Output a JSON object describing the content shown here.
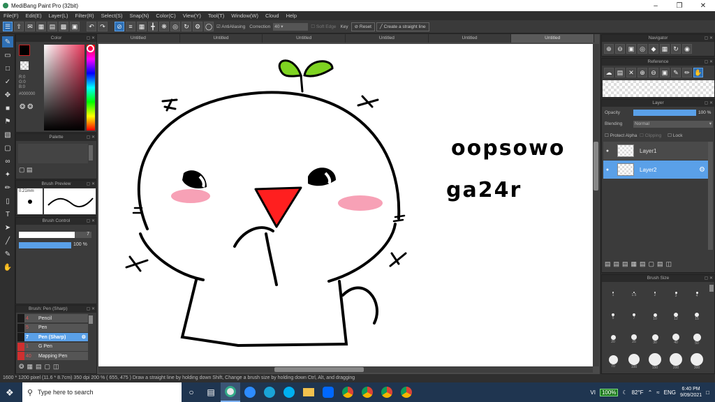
{
  "window": {
    "title": "MediBang Paint Pro (32bit)"
  },
  "menu": [
    "File(F)",
    "Edit(E)",
    "Layer(L)",
    "Filter(R)",
    "Select(S)",
    "Snap(N)",
    "Color(C)",
    "View(Y)",
    "Tool(T)",
    "Window(W)",
    "Cloud",
    "Help"
  ],
  "toolbar": {
    "antialias": "AntiAliasing",
    "correction_label": "Correction",
    "correction_value": "40",
    "soft_edge": "Soft Edge",
    "key": "Key",
    "reset": "Reset",
    "straight_line": "Create a straight line"
  },
  "color_panel": {
    "title": "Color",
    "r": "R:0",
    "g": "G:0",
    "b": "B:0",
    "hex": "#000000"
  },
  "palette": {
    "title": "Palette"
  },
  "brush_preview": {
    "title": "Brush Preview",
    "size": "0.21mm"
  },
  "brush_control": {
    "title": "Brush Control",
    "size_value": "7",
    "opacity_value": "100 %"
  },
  "brush_list": {
    "title": "Brush: Pen (Sharp)",
    "items": [
      {
        "num": "4",
        "name": "Pencil",
        "color": "#1a1a1a",
        "selected": false
      },
      {
        "num": "5",
        "name": "Pen",
        "color": "#1a1a1a",
        "selected": false
      },
      {
        "num": "7",
        "name": "Pen (Sharp)",
        "color": "#1a1a1a",
        "selected": true
      },
      {
        "num": "1",
        "name": "G Pen",
        "color": "#d03030",
        "selected": false
      },
      {
        "num": "40",
        "name": "Mapping Pen",
        "color": "#d03030",
        "selected": false
      }
    ]
  },
  "tabs": [
    "Untitled",
    "Untitled",
    "Untitled",
    "Untitled",
    "Untitled",
    "Untitled"
  ],
  "canvas_text": {
    "line1": "oopsowo",
    "line2": "ga24r"
  },
  "navigator": {
    "title": "Navigator"
  },
  "reference": {
    "title": "Reference"
  },
  "layer_panel": {
    "title": "Layer",
    "opacity_label": "Opacity",
    "opacity_value": "100 %",
    "blending_label": "Blending",
    "blending_value": "Normal",
    "protect_alpha": "Protect Alpha",
    "clipping": "Clipping",
    "lock": "Lock",
    "layers": [
      {
        "name": "Layer1",
        "selected": false
      },
      {
        "name": "Layer2",
        "selected": true
      }
    ]
  },
  "brush_size": {
    "title": "Brush Size",
    "labels": [
      "1",
      "1.5",
      "2",
      "3",
      "4",
      "5",
      "7",
      "10",
      "12",
      "15",
      "20",
      "25",
      "30",
      "40",
      "50",
      "70",
      "100",
      "150",
      "200",
      "300"
    ]
  },
  "status": "1600 * 1200 pixel   (11.6 * 8.7cm)   350 dpi   200 %   ( 655, 475 )   Draw a straight line by holding down Shift, Change a brush size by holding down Ctrl, Alt, and dragging",
  "taskbar": {
    "search_placeholder": "Type here to search",
    "battery": "100%",
    "weather": "82°F",
    "lang": "ENG",
    "time": "6:40 PM",
    "date": "9/09/2021"
  }
}
